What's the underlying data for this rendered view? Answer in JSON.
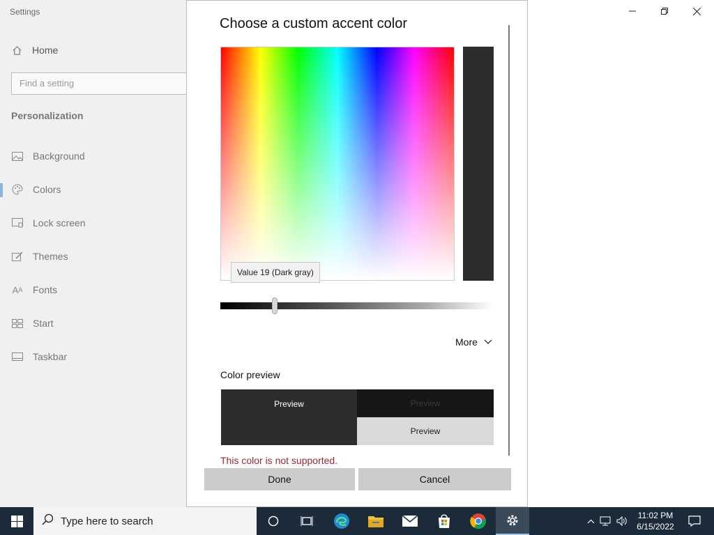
{
  "settings": {
    "window_title": "Settings",
    "home_label": "Home",
    "search_placeholder": "Find a setting",
    "section_title": "Personalization",
    "nav_items": [
      {
        "label": "Background",
        "icon": "image-icon"
      },
      {
        "label": "Colors",
        "icon": "palette-icon"
      },
      {
        "label": "Lock screen",
        "icon": "lock-screen-icon"
      },
      {
        "label": "Themes",
        "icon": "themes-icon"
      },
      {
        "label": "Fonts",
        "icon": "fonts-icon"
      },
      {
        "label": "Start",
        "icon": "start-icon"
      },
      {
        "label": "Taskbar",
        "icon": "taskbar-icon"
      }
    ],
    "active_nav": "Colors",
    "controls": {
      "minimize": "—",
      "restore": "❐",
      "close": "✕"
    }
  },
  "dialog": {
    "title": "Choose a custom accent color",
    "value_color": "#2d2d2d",
    "tooltip": "Value 19 (Dark gray)",
    "slider_value_fraction": 0.19,
    "more_label": "More",
    "preview_label": "Color preview",
    "preview_main": "Preview",
    "preview_dark": "Preview",
    "preview_light": "Preview",
    "error": "This color is not supported.",
    "done_label": "Done",
    "cancel_label": "Cancel"
  },
  "taskbar": {
    "search_placeholder": "Type here to search",
    "time": "11:02 PM",
    "date": "6/15/2022",
    "apps": [
      "cortana-icon",
      "task-view-icon",
      "edge-icon",
      "file-explorer-icon",
      "mail-icon",
      "store-icon",
      "chrome-icon",
      "settings-icon"
    ],
    "active_app": "settings-icon"
  }
}
